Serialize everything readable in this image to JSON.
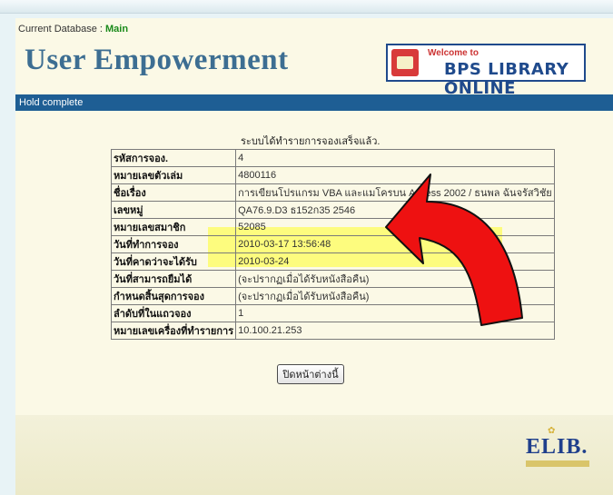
{
  "header": {
    "database_label": "Current Database :",
    "database_name": "Main",
    "app_title": "User Empowerment",
    "banner_welcome": "Welcome to",
    "banner_title": "BPS LIBRARY ONLINE"
  },
  "status": {
    "text": "Hold complete"
  },
  "main": {
    "caption": "ระบบได้ทำรายการจองเสร็จแล้ว.",
    "rows": [
      {
        "label": "รหัสการจอง.",
        "value": "4"
      },
      {
        "label": "หมายเลขตัวเล่ม",
        "value": "4800116"
      },
      {
        "label": "ชื่อเรื่อง",
        "value": "การเขียนโปรแกรม VBA และแมโครบน Access 2002 / ธนพล ฉันจรัสวิชัย"
      },
      {
        "label": "เลขหมู่",
        "value": "QA76.9.D3 ธ152ก35 2546"
      },
      {
        "label": "หมายเลขสมาชิก",
        "value": "52085"
      },
      {
        "label": "วันที่ทำการจอง",
        "value": "2010-03-17 13:56:48"
      },
      {
        "label": "วันที่คาดว่าจะได้รับ",
        "value": "2010-03-24"
      },
      {
        "label": "วันที่สามารถยืมได้",
        "value": "(จะปรากฏเมื่อได้รับหนังสือคืน)"
      },
      {
        "label": "กำหนดสิ้นสุดการจอง",
        "value": "(จะปรากฏเมื่อได้รับหนังสือคืน)"
      },
      {
        "label": "ลำดับที่ในแถวจอง",
        "value": "1"
      },
      {
        "label": "หมายเลขเครื่องที่ทำรายการ",
        "value": "10.100.21.253"
      }
    ],
    "close_button": "ปิดหน้าต่างนี้"
  },
  "footer": {
    "logo_text": "ELIB."
  },
  "colors": {
    "header_bar": "#1e5e94",
    "title": "#3d6e92",
    "highlight": "#ffff28",
    "arrow": "#ee1111"
  }
}
